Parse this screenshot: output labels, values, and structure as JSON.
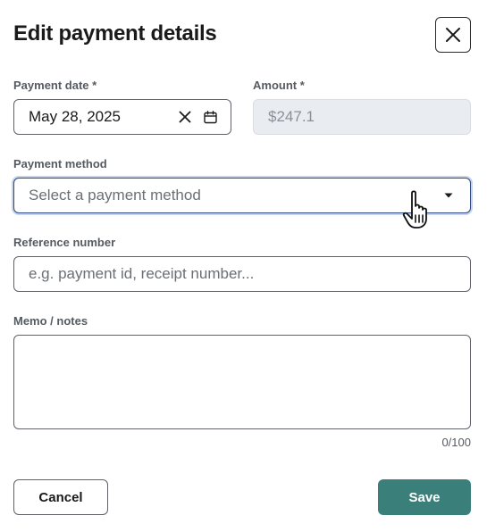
{
  "dialog": {
    "title": "Edit payment details"
  },
  "payment_date": {
    "label": "Payment date *",
    "value": "May 28, 2025"
  },
  "amount": {
    "label": "Amount *",
    "value": "$247.1"
  },
  "payment_method": {
    "label": "Payment method",
    "placeholder": "Select a payment method"
  },
  "reference_number": {
    "label": "Reference number",
    "placeholder": "e.g. payment id, receipt number..."
  },
  "memo": {
    "label": "Memo / notes",
    "counter": "0/100"
  },
  "actions": {
    "cancel_label": "Cancel",
    "save_label": "Save"
  },
  "colors": {
    "save_button": "#3b7f7b",
    "focus_border": "#2f4a7f"
  },
  "icons": {
    "close": "close-icon",
    "clear": "clear-icon",
    "calendar": "calendar-icon",
    "dropdown": "caret-down-icon",
    "pointer": "hand-pointer-icon"
  }
}
